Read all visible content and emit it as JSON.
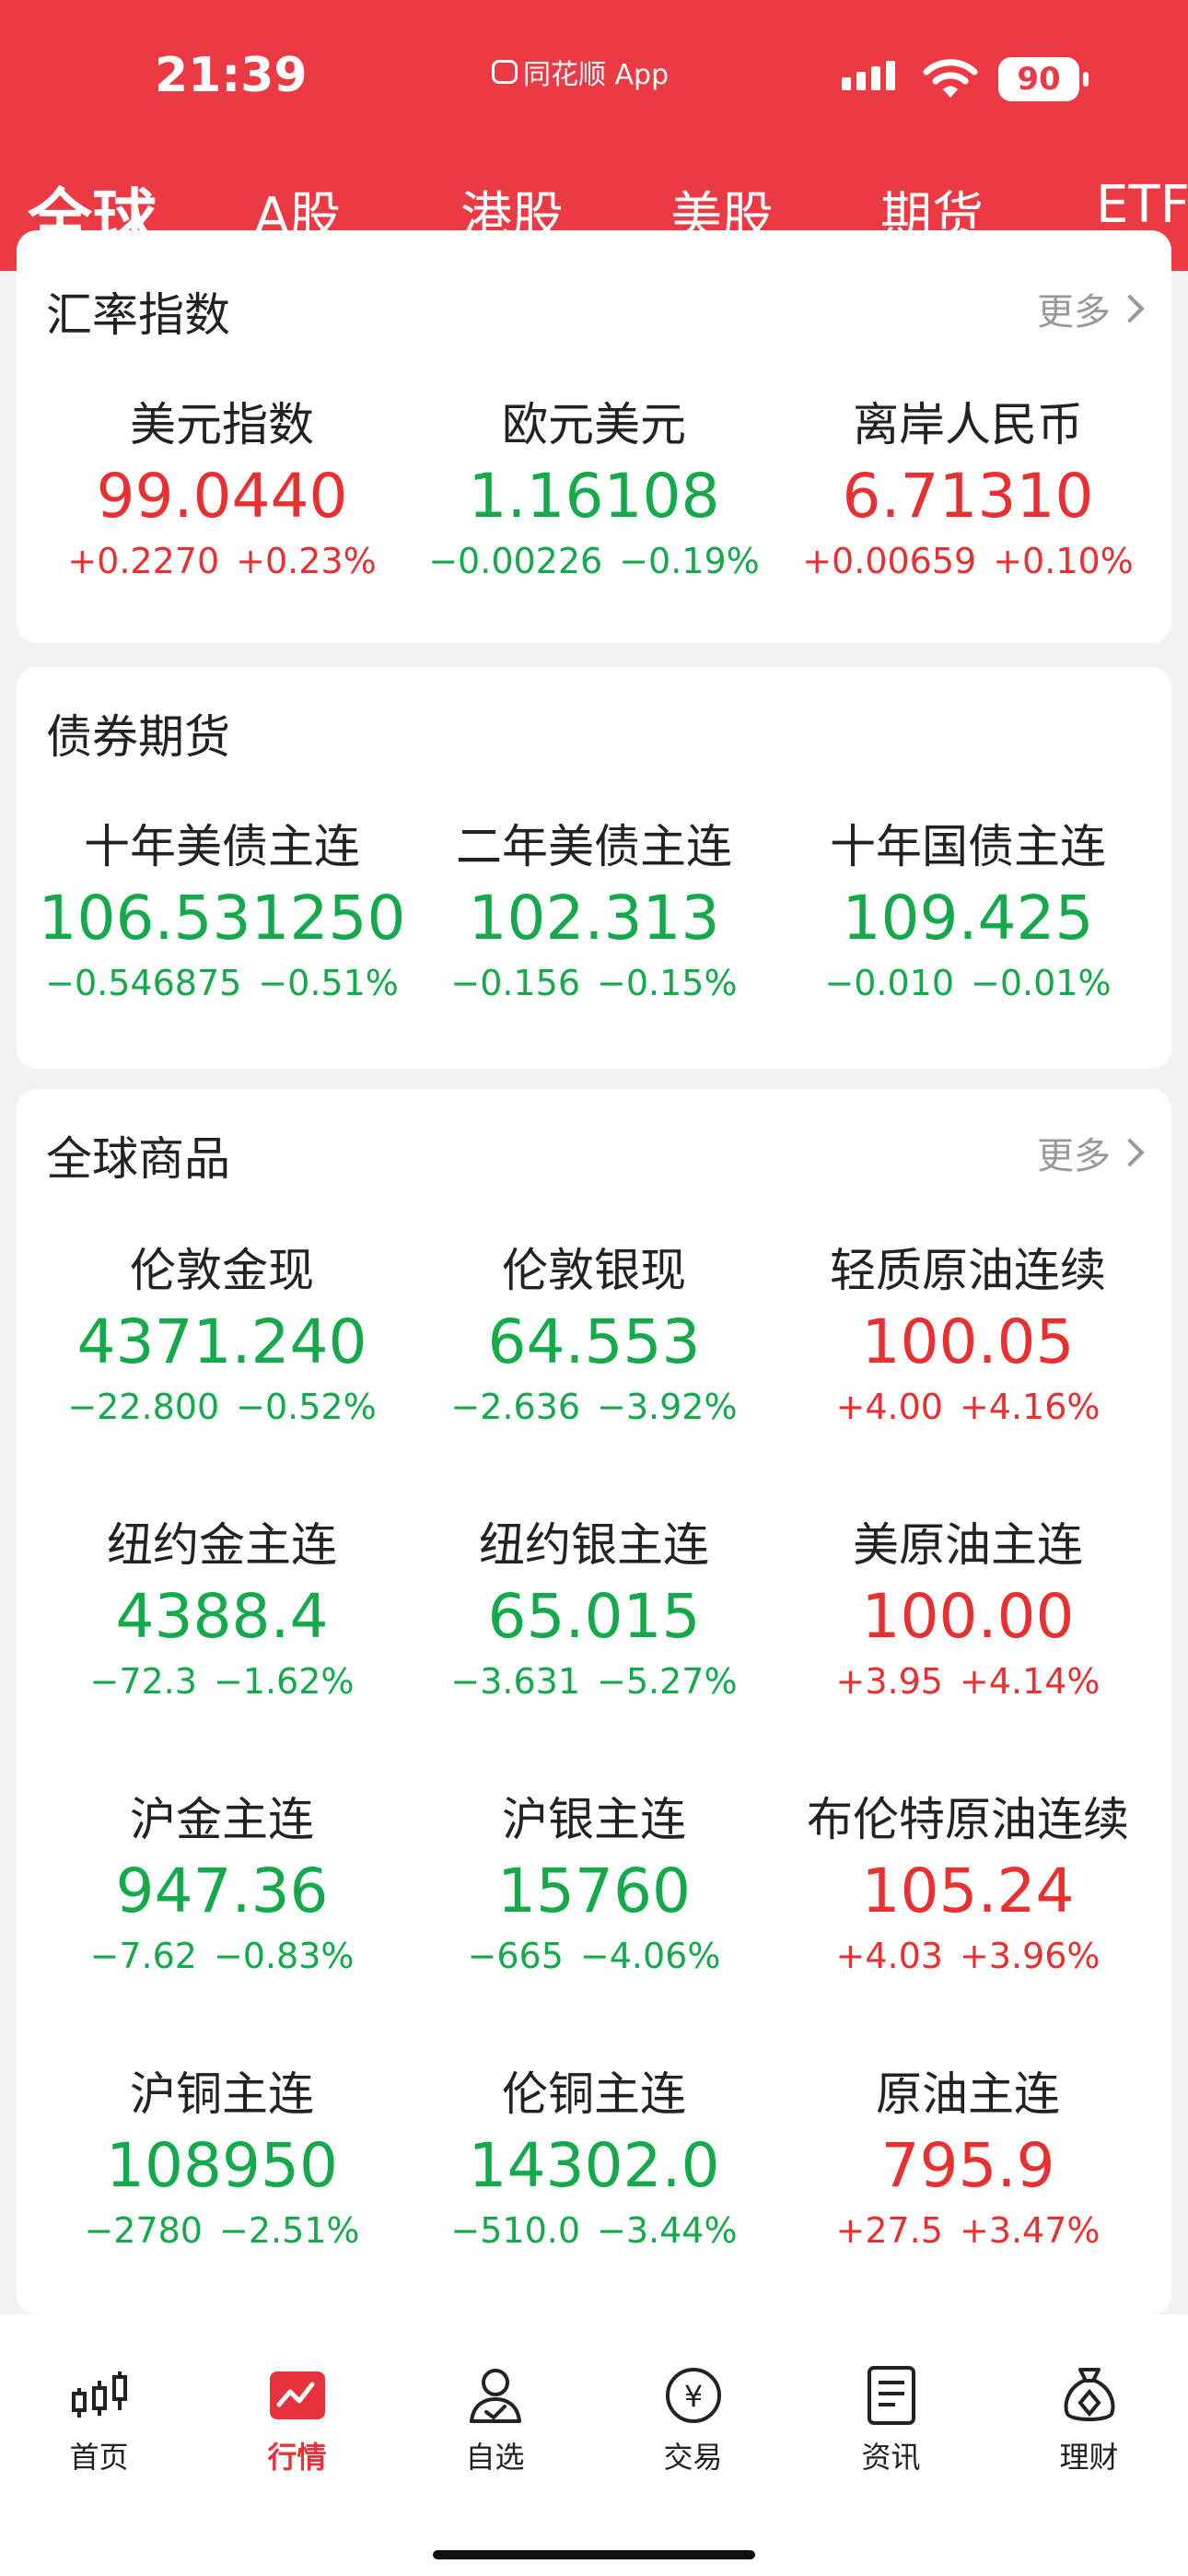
{
  "status_bar": {
    "time": "21:39",
    "app": "同花顺 App",
    "battery": "90"
  },
  "tabs": [
    "全球",
    "A股",
    "港股",
    "美股",
    "期货",
    "ETF"
  ],
  "sections": [
    {
      "title": "汇率指数",
      "more": "更多",
      "items": [
        {
          "name": "美元指数",
          "value": "99.0440",
          "change": "+0.2270",
          "pct": "+0.23%",
          "dir": "up"
        },
        {
          "name": "欧元美元",
          "value": "1.16108",
          "change": "−0.00226",
          "pct": "−0.19%",
          "dir": "down"
        },
        {
          "name": "离岸人民币",
          "value": "6.71310",
          "change": "+0.00659",
          "pct": "+0.10%",
          "dir": "up"
        }
      ]
    },
    {
      "title": "债券期货",
      "items": [
        {
          "name": "十年美债主连",
          "value": "106.531250",
          "change": "−0.546875",
          "pct": "−0.51%",
          "dir": "down"
        },
        {
          "name": "二年美债主连",
          "value": "102.313",
          "change": "−0.156",
          "pct": "−0.15%",
          "dir": "down"
        },
        {
          "name": "十年国债主连",
          "value": "109.425",
          "change": "−0.010",
          "pct": "−0.01%",
          "dir": "down"
        }
      ]
    },
    {
      "title": "全球商品",
      "more": "更多",
      "items": [
        {
          "name": "伦敦金现",
          "value": "4371.240",
          "change": "−22.800",
          "pct": "−0.52%",
          "dir": "down"
        },
        {
          "name": "伦敦银现",
          "value": "64.553",
          "change": "−2.636",
          "pct": "−3.92%",
          "dir": "down"
        },
        {
          "name": "轻质原油连续",
          "value": "100.05",
          "change": "+4.00",
          "pct": "+4.16%",
          "dir": "up"
        },
        {
          "name": "纽约金主连",
          "value": "4388.4",
          "change": "−72.3",
          "pct": "−1.62%",
          "dir": "down"
        },
        {
          "name": "纽约银主连",
          "value": "65.015",
          "change": "−3.631",
          "pct": "−5.27%",
          "dir": "down"
        },
        {
          "name": "美原油主连",
          "value": "100.00",
          "change": "+3.95",
          "pct": "+4.14%",
          "dir": "up"
        },
        {
          "name": "沪金主连",
          "value": "947.36",
          "change": "−7.62",
          "pct": "−0.83%",
          "dir": "down"
        },
        {
          "name": "沪银主连",
          "value": "15760",
          "change": "−665",
          "pct": "−4.06%",
          "dir": "down"
        },
        {
          "name": "布伦特原油连续",
          "value": "105.24",
          "change": "+4.03",
          "pct": "+3.96%",
          "dir": "up"
        },
        {
          "name": "沪铜主连",
          "value": "108950",
          "change": "−2780",
          "pct": "−2.51%",
          "dir": "down"
        },
        {
          "name": "伦铜主连",
          "value": "14302.0",
          "change": "−510.0",
          "pct": "−3.44%",
          "dir": "down"
        },
        {
          "name": "原油主连",
          "value": "795.9",
          "change": "+27.5",
          "pct": "+3.47%",
          "dir": "up"
        }
      ]
    }
  ],
  "bottom_nav": [
    {
      "label": "首页",
      "icon": "candlestick-icon"
    },
    {
      "label": "行情",
      "icon": "market-chart-icon",
      "active": true
    },
    {
      "label": "自选",
      "icon": "user-check-icon"
    },
    {
      "label": "交易",
      "icon": "yuan-coin-icon"
    },
    {
      "label": "资讯",
      "icon": "news-document-icon"
    },
    {
      "label": "理财",
      "icon": "money-bag-icon"
    }
  ],
  "colors": {
    "brand": "#ec3a44",
    "up": "#e93030",
    "down": "#14a94a"
  }
}
